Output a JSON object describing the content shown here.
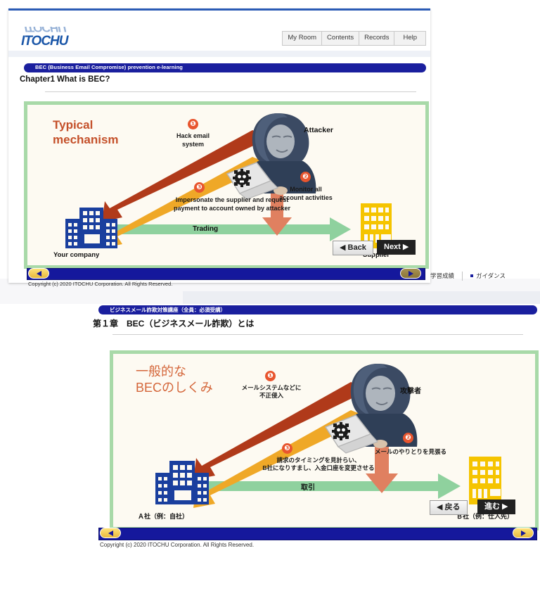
{
  "english_panel": {
    "logo_text": "ITOCHU",
    "nav_tabs": [
      {
        "label": "My Room"
      },
      {
        "label": "Contents"
      },
      {
        "label": "Records"
      },
      {
        "label": "Help"
      }
    ],
    "course_bar_label": "BEC (Business Email Compromise) prevention e-learning",
    "chapter_title": "Chapter1 What is BEC?",
    "diagram": {
      "title": "Typical\nmechanism",
      "attacker_label": "Attacker",
      "your_company_label": "Your company",
      "supplier_label": "Supplier",
      "trading_label": "Trading",
      "steps": [
        {
          "num": "❶",
          "text": "Hack email\nsystem"
        },
        {
          "num": "❷",
          "text": "Monitor all\naccount activities"
        },
        {
          "num": "❸",
          "text": "Impersonate the supplier and request\npayment to account owned by attacker"
        }
      ],
      "back_button": "◀ Back",
      "next_button": "Next ▶"
    },
    "footer_copyright": "Copyright (c) 2020 ITOCHU Corporation. All Rights Reserved.",
    "prev_nav_icon": "triangle-left-icon",
    "next_nav_icon": "triangle-right-icon"
  },
  "global_links": {
    "records_label": "学習成績",
    "guidance_label": "ガイダンス"
  },
  "japanese_panel": {
    "course_bar_label": "ビジネスメール詐欺対策講座（全員：必須受講）",
    "chapter_title": "第１章　BEC（ビジネスメール詐欺）とは",
    "diagram": {
      "title": "一般的な\nBECのしくみ",
      "attacker_label": "攻撃者",
      "company_a_label": "Ａ社（例：自社）",
      "company_b_label": "Ｂ社（例：仕入先）",
      "trading_label": "取引",
      "steps": [
        {
          "num": "❶",
          "text": "メールシステムなどに\n不正侵入"
        },
        {
          "num": "❷",
          "text": "メールのやりとりを見張る"
        },
        {
          "num": "❸",
          "text": "請求のタイミングを見計らい、\nB社になりすまし、入金口座を変更させる"
        }
      ],
      "back_button": "◀ 戻る",
      "next_button": "進む ▶"
    },
    "footer_copyright": "Copyright (c) 2020 ITOCHU Corporation. All Rights Reserved.",
    "prev_nav_icon": "triangle-left-icon",
    "next_nav_icon": "triangle-right-icon"
  },
  "colors": {
    "brand_blue": "#1a56a8",
    "course_bar": "#1a1f9e",
    "diagram_border": "#a8d9a8",
    "diagram_bg": "#fdfaf2",
    "step_badge": "#e8552e",
    "arrow_red": "#b03a1a",
    "arrow_orange": "#efa827",
    "arrow_salmon": "#e08060",
    "arrow_green": "#8fd19e",
    "company_blue": "#1a3f9e",
    "supplier_yellow": "#f5c400",
    "title_orange": "#c4502a"
  }
}
